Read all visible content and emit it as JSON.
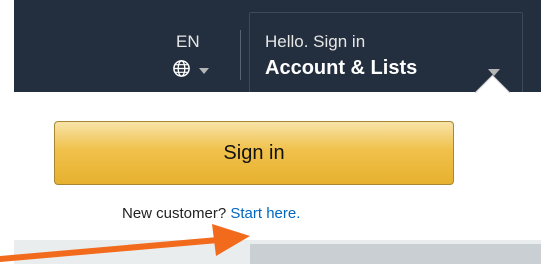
{
  "nav": {
    "language_code": "EN",
    "greeting": "Hello. Sign in",
    "account_label": "Account & Lists"
  },
  "dropdown": {
    "signin_label": "Sign in",
    "new_customer_text": "New customer? ",
    "start_here_link": "Start here."
  },
  "icons": {
    "globe": "globe-icon",
    "language_caret": "caret-down-icon",
    "account_caret": "caret-down-icon"
  },
  "colors": {
    "navbar": "#232f3e",
    "button_gold": "#f0c14b",
    "link_blue": "#0066c0",
    "annotation_arrow": "#f26b1d"
  }
}
